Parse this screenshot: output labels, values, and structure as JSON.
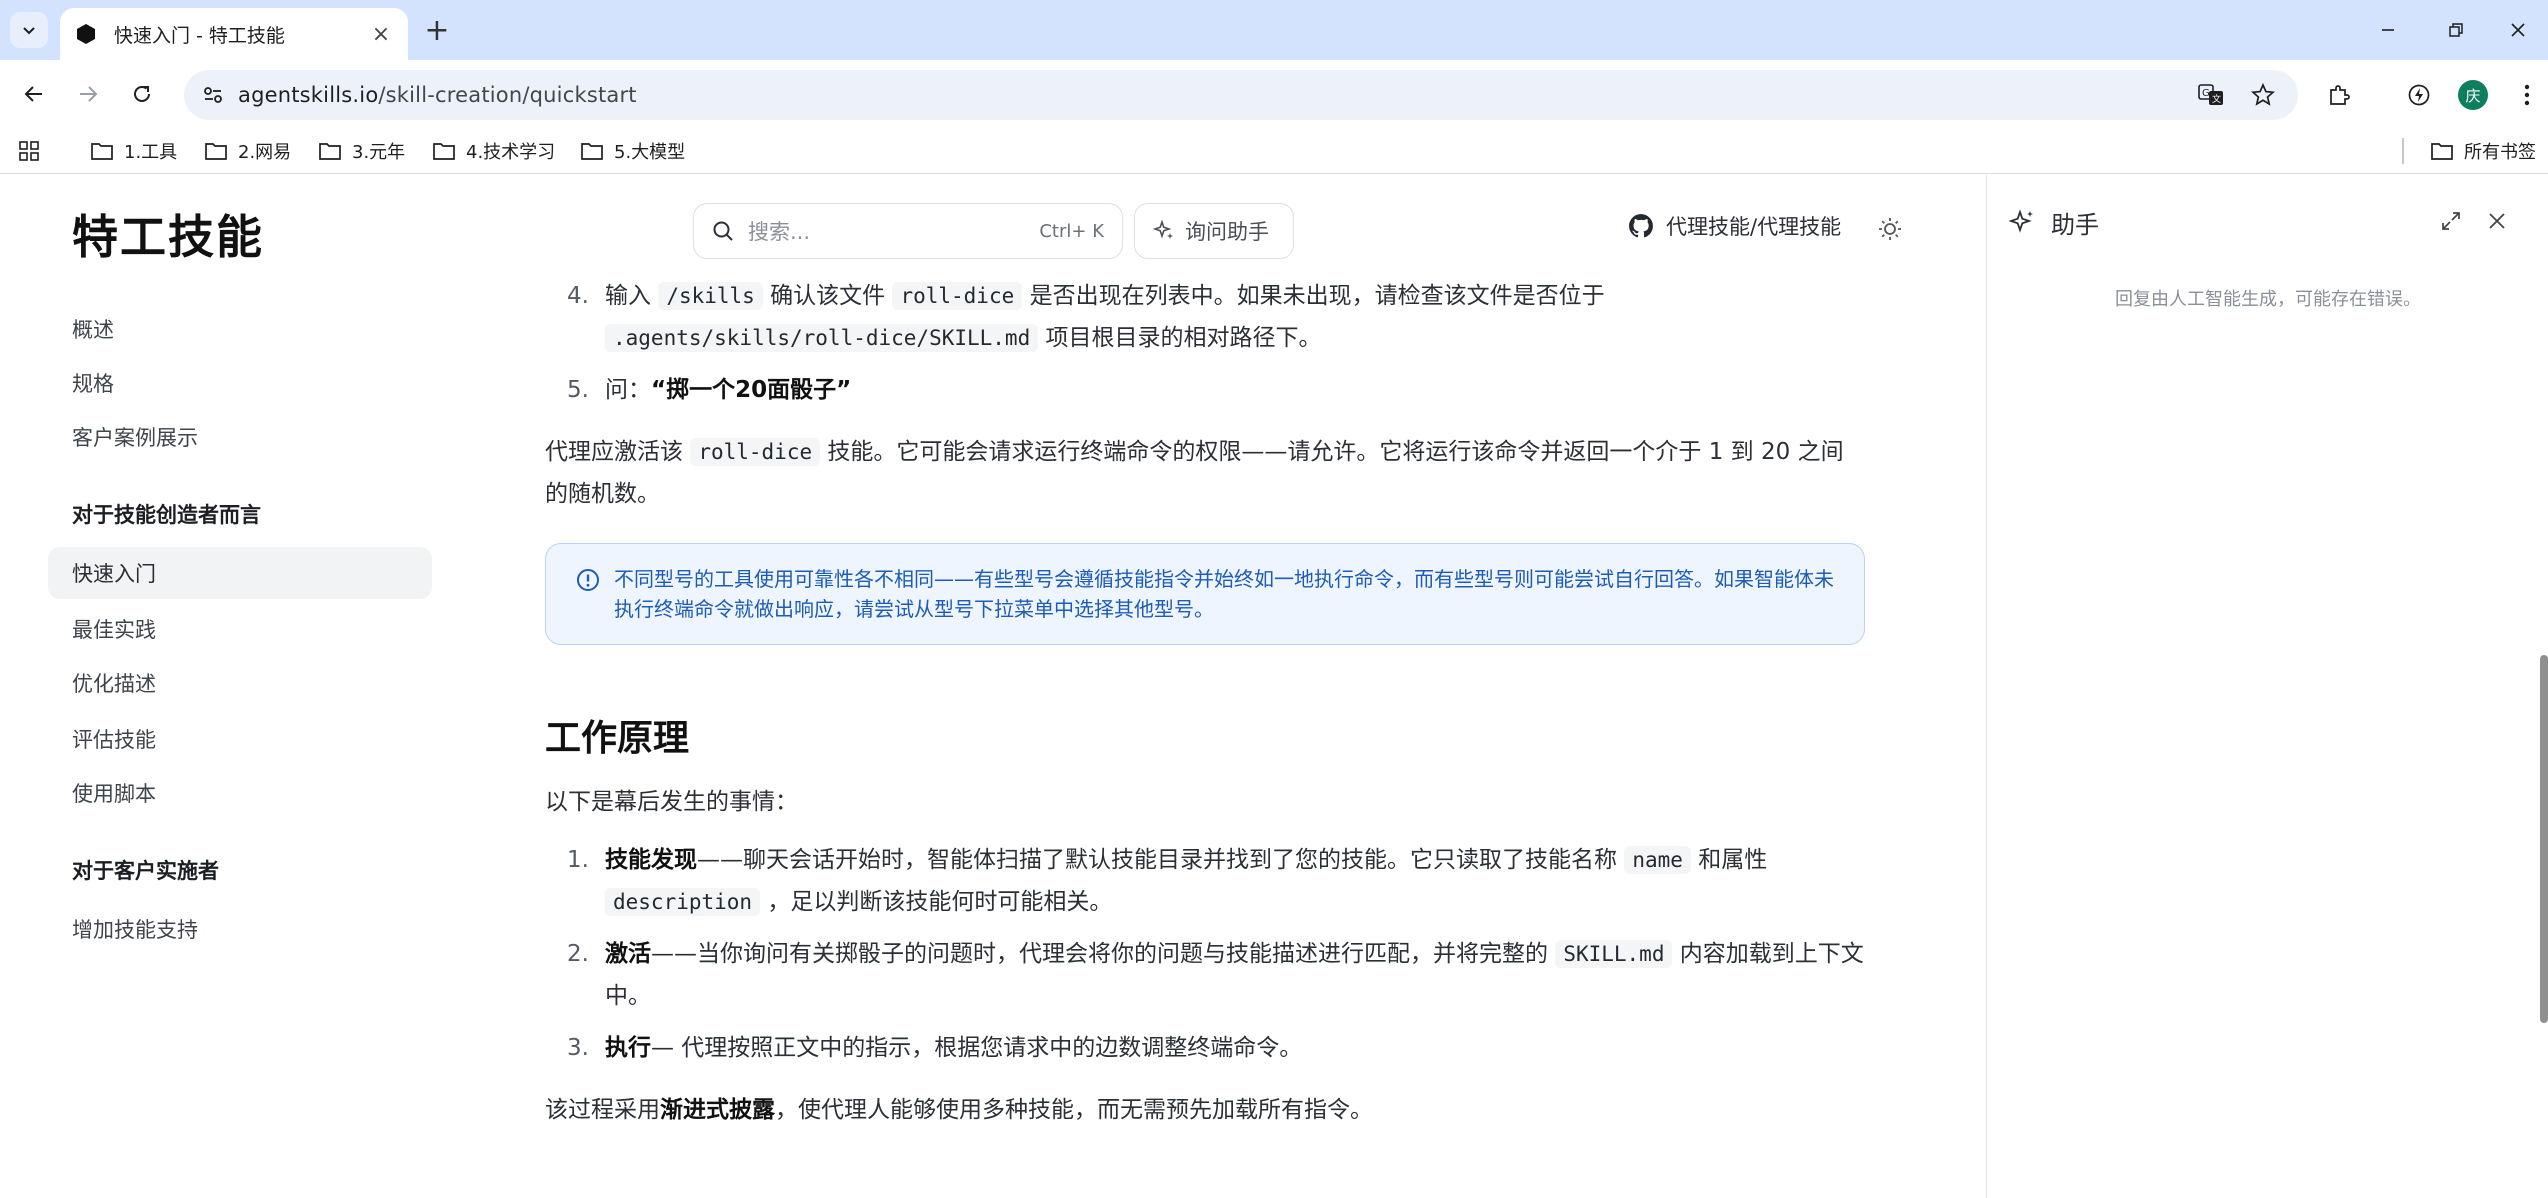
{
  "browser": {
    "tab_title": "快速入门 - 特工技能",
    "url_host": "agentskills.io",
    "url_path": "/skill-creation/quickstart",
    "avatar_initial": "庆",
    "bookmarks": [
      "1.工具",
      "2.网易",
      "3.元年",
      "4.技术学习",
      "5.大模型"
    ],
    "all_bookmarks": "所有书签"
  },
  "header": {
    "logo": "特工技能",
    "search_placeholder": "搜索...",
    "search_shortcut": "Ctrl+ K",
    "ask_label": "询问助手",
    "github_label": "代理技能/代理技能"
  },
  "sidebar": {
    "items_top": [
      "概述",
      "规格",
      "客户案例展示"
    ],
    "section_creators": "对于技能创造者而言",
    "items_creators": [
      "快速入门",
      "最佳实践",
      "优化描述",
      "评估技能",
      "使用脚本"
    ],
    "section_clients": "对于客户实施者",
    "items_clients": [
      "增加技能支持"
    ]
  },
  "content": {
    "step4_a": "输入",
    "step4_code1": "/skills",
    "step4_b": "确认该文件",
    "step4_code2": "roll-dice",
    "step4_c": "是否出现在列表中。如果未出现，请检查该文件是否位于",
    "step4_code3": ".agents/skills/roll-dice/SKILL.md",
    "step4_d": "项目根目录的相对路径下。",
    "step5_a": "问：",
    "step5_b": "“掷一个20面骰子”",
    "para1_a": "代理应激活该",
    "para1_code": "roll-dice",
    "para1_b": "技能。它可能会请求运行终端命令的权限——请允许。它将运行该命令并返回一个介于 1 到 20 之间的随机数。",
    "callout": "不同型号的工具使用可靠性各不相同——有些型号会遵循技能指令并始终如一地执行命令，而有些型号则可能尝试自行回答。如果智能体未执行终端命令就做出响应，请尝试从型号下拉菜单中选择其他型号。",
    "heading": "工作原理",
    "intro": "以下是幕后发生的事情：",
    "hw1_bold": "技能发现",
    "hw1_a": "——聊天会话开始时，智能体扫描了默认技能目录并找到了您的技能。它只读取了技能名称",
    "hw1_code1": "name",
    "hw1_b": "和属性",
    "hw1_code2": "description",
    "hw1_c": "，足以判断该技能何时可能相关。",
    "hw2_bold": "激活",
    "hw2_a": "——当你询问有关掷骰子的问题时，代理会将你的问题与技能描述进行匹配，并将完整的",
    "hw2_code": "SKILL.md",
    "hw2_b": "内容加载到上下文中。",
    "hw3_bold": "执行",
    "hw3_a": "— 代理按照正文中的指示，根据您请求中的边数调整终端命令。",
    "final_a": "该过程采用",
    "final_bold": "渐进式披露",
    "final_b": "，使代理人能够使用多种技能，而无需预先加载所有指令。"
  },
  "assistant": {
    "title": "助手",
    "note": "回复由人工智能生成，可能存在错误。"
  }
}
